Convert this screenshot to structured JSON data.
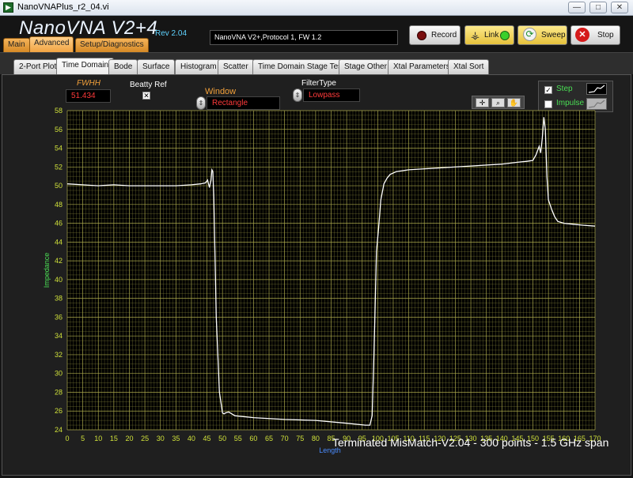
{
  "window": {
    "title": "NanoVNAPlus_r2_04.vi",
    "min_label": "—",
    "max_label": "□",
    "close_label": "✕"
  },
  "app": {
    "logo": "NanoVNA V2+4",
    "rev": "Rev 2.04",
    "info": "NanoVNA V2+,Protocol 1, FW 1.2"
  },
  "main_tabs": [
    "Main",
    "Advanced",
    "Setup/Diagnostics"
  ],
  "buttons": {
    "record": "Record",
    "link": "Link",
    "sweep": "Sweep",
    "stop": "Stop"
  },
  "colors": {
    "record_dot": "#7a0f0f",
    "link_dot": "#3bd02a",
    "stop_icon": "#d51a1a",
    "trace": "#ffffff",
    "grid": "#a8a64a",
    "plot_bg": "#000000",
    "axis_text": "#cfe03a",
    "axis_title": "#4ade54"
  },
  "sub_tabs": [
    "2-Port Plot",
    "Time Domain",
    "Bode",
    "Surface",
    "Histogram",
    "Scatter",
    "Time Domain Stage Test",
    "Stage Other",
    "Xtal Parameters",
    "Xtal Sort"
  ],
  "controls": {
    "fwhh_label": "FWHH",
    "fwhh_value": "51.434",
    "beatty_label": "Beatty Ref",
    "window_label": "Window",
    "window_value": "Rectangle",
    "filter_label": "FilterType",
    "filter_value": "Lowpass"
  },
  "legend": {
    "step_label": "Step",
    "step_checked": true,
    "impulse_label": "Impulse",
    "impulse_checked": false
  },
  "caption": "Terminated MisMatch-V2.04 - 300 points - 1.5 GHz span",
  "chart_data": {
    "type": "line",
    "title": "",
    "xlabel": "Length",
    "ylabel": "Impedance",
    "xlim": [
      0,
      170
    ],
    "ylim": [
      24,
      58
    ],
    "x_ticks": [
      0,
      5,
      10,
      15,
      20,
      25,
      30,
      35,
      40,
      45,
      50,
      55,
      60,
      65,
      70,
      75,
      80,
      85,
      90,
      95,
      100,
      105,
      110,
      115,
      120,
      125,
      130,
      135,
      140,
      145,
      150,
      155,
      160,
      165,
      170
    ],
    "y_ticks": [
      24,
      26,
      28,
      30,
      32,
      34,
      36,
      38,
      40,
      42,
      44,
      46,
      48,
      50,
      52,
      54,
      56,
      58
    ],
    "grid": true,
    "series": [
      {
        "x": [
          0,
          5,
          10,
          15,
          20,
          25,
          30,
          35,
          40,
          43,
          44.5,
          45.2,
          45.8,
          46.3,
          46.6,
          46.9,
          47.2,
          48,
          49,
          50,
          50.5,
          51,
          52,
          54,
          60,
          70,
          80,
          90,
          96,
          97.5,
          98.2,
          98.8,
          99.6,
          100.3,
          101,
          102,
          103,
          104,
          106,
          110,
          120,
          130,
          140,
          145,
          148,
          150,
          151,
          152,
          152.5,
          153,
          153.5,
          154,
          154.5,
          155,
          156,
          157,
          158,
          160,
          163,
          166,
          170
        ],
        "y": [
          50.2,
          50.1,
          50.0,
          50.1,
          50.0,
          50.0,
          50.0,
          50.0,
          50.1,
          50.2,
          50.3,
          50.6,
          49.8,
          50.6,
          51.7,
          51.5,
          48.8,
          36,
          28,
          25.8,
          25.7,
          25.8,
          25.9,
          25.5,
          25.3,
          25.1,
          25.0,
          24.7,
          24.5,
          24.5,
          25.5,
          32,
          43,
          45.5,
          48.5,
          50.2,
          50.8,
          51.2,
          51.5,
          51.7,
          51.9,
          52.1,
          52.3,
          52.5,
          52.6,
          52.7,
          53.3,
          54.2,
          53.5,
          55,
          57.3,
          56,
          51,
          48.5,
          47.5,
          46.7,
          46.2,
          46.0,
          45.9,
          45.8,
          45.7
        ]
      }
    ]
  }
}
